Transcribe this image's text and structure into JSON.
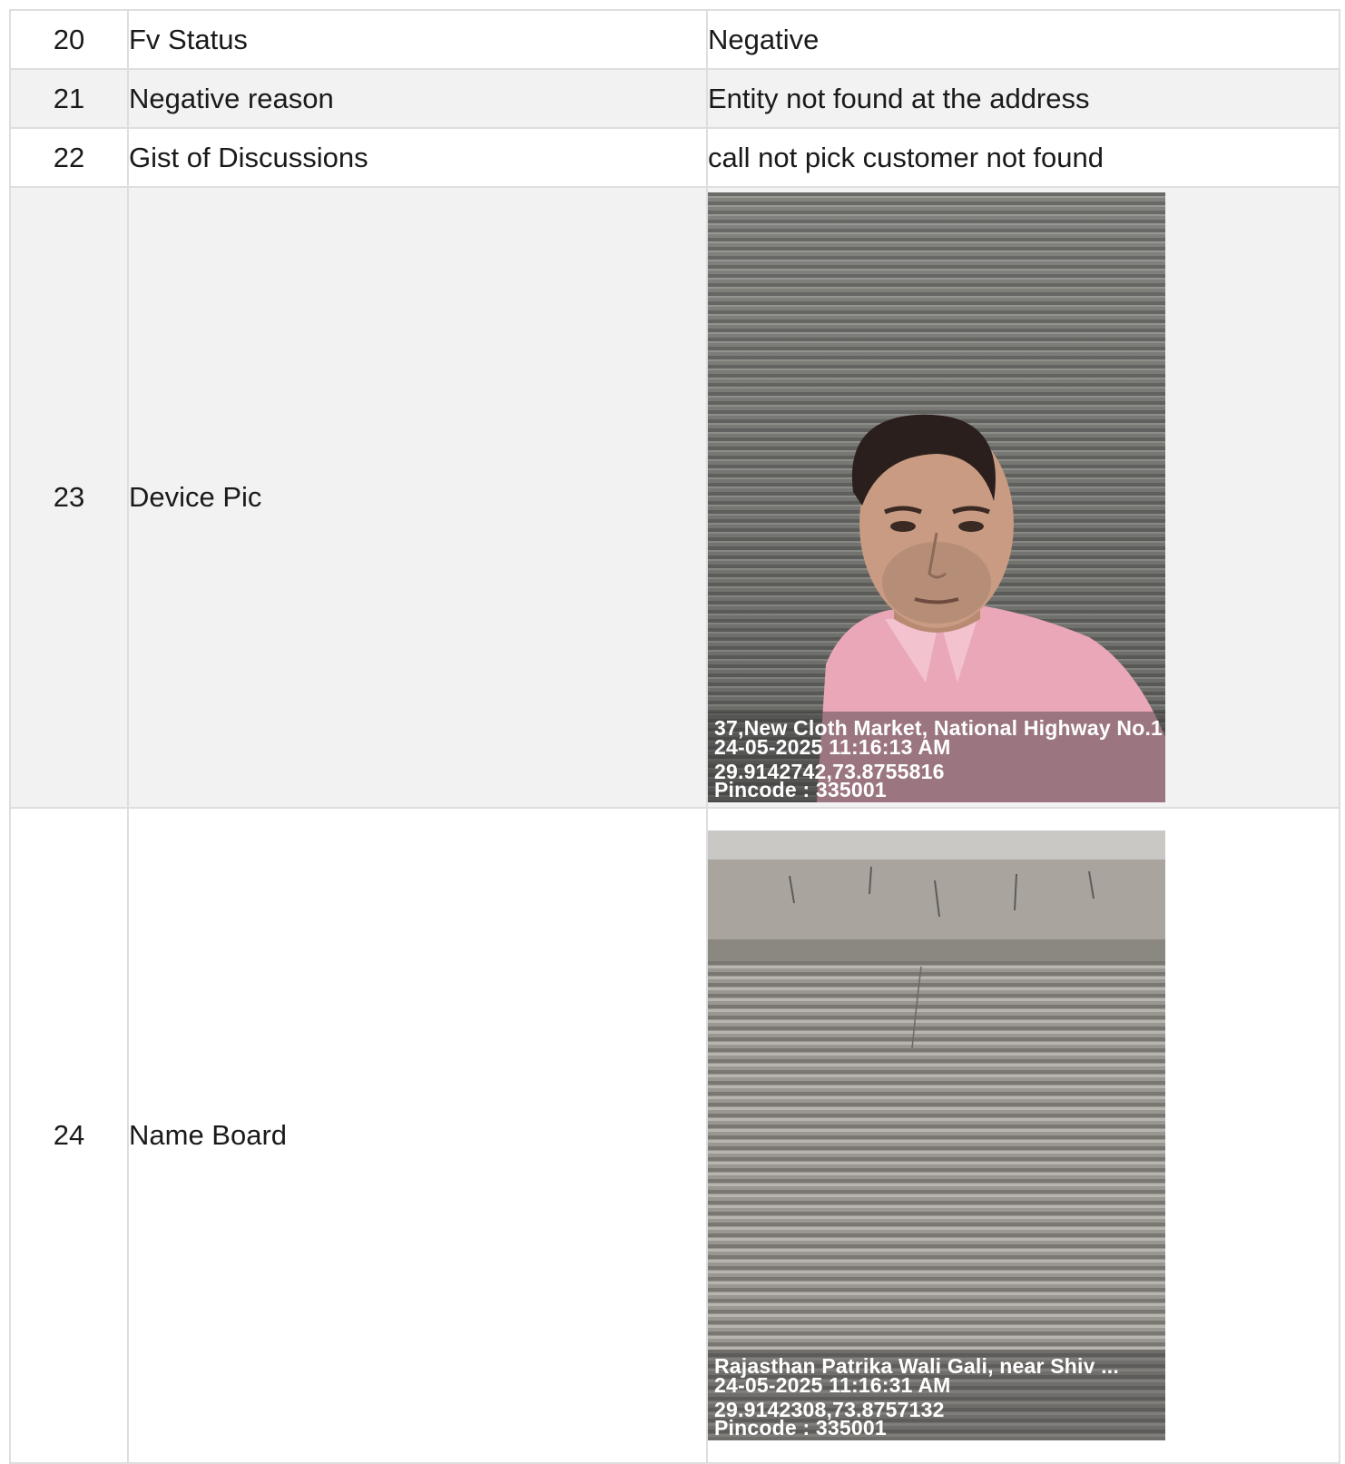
{
  "rows": [
    {
      "num": "20",
      "field": "Fv Status",
      "value": "Negative"
    },
    {
      "num": "21",
      "field": "Negative reason",
      "value": "Entity not found at the address"
    },
    {
      "num": "22",
      "field": "Gist of Discussions",
      "value": "call not pick customer not found"
    },
    {
      "num": "23",
      "field": "Device Pic",
      "photo": {
        "address": "37,New Cloth Market, National Highway No.1",
        "datetime": "24-05-2025 11:16:13 AM",
        "coords": "29.9142742,73.8755816",
        "pincode": "Pincode : 335001"
      }
    },
    {
      "num": "24",
      "field": "Name Board",
      "photo": {
        "address": "Rajasthan Patrika Wali Gali, near Shiv ...",
        "datetime": "24-05-2025 11:16:31 AM",
        "coords": "29.9142308,73.8757132",
        "pincode": "Pincode : 335001"
      }
    }
  ],
  "colors": {
    "row_alt": "#f2f2f2",
    "border": "#dedede",
    "text": "#1a1a1a",
    "shirt": "#e9a7b8"
  }
}
